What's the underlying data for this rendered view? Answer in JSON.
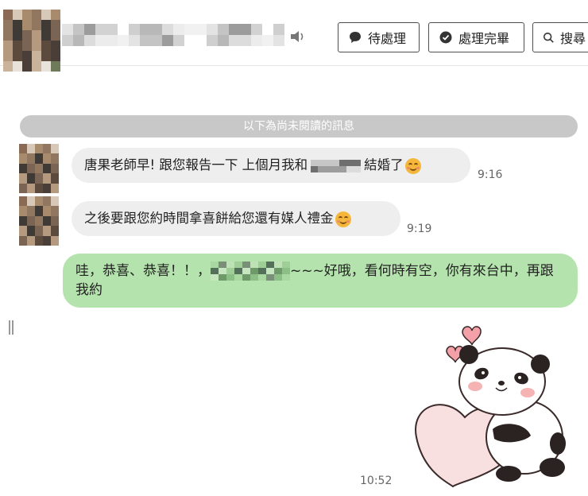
{
  "header": {
    "buttons": {
      "pending": "待處理",
      "done": "處理完畢",
      "search": "搜尋"
    }
  },
  "chat": {
    "unread_divider": "以下為尚未閱讀的訊息",
    "messages": [
      {
        "direction": "in",
        "text_before": "唐果老師早! 跟您報告一下 上個月我和",
        "text_after": "結婚了",
        "time": "9:16"
      },
      {
        "direction": "in",
        "text": "之後要跟您約時間拿喜餅給您還有媒人禮金",
        "time": "9:19"
      },
      {
        "direction": "out",
        "text_before": "哇，恭喜、恭喜！！，",
        "text_after": "~~~好哦，看何時有空，你有來台中，再跟我約"
      },
      {
        "direction": "out",
        "type": "sticker",
        "sticker": "panda-hugging-heart",
        "time": "10:52"
      }
    ]
  },
  "colors": {
    "incoming_bubble": "#eeeeee",
    "outgoing_bubble": "#b5e3ad",
    "unread_divider": "#c8c8c8"
  }
}
